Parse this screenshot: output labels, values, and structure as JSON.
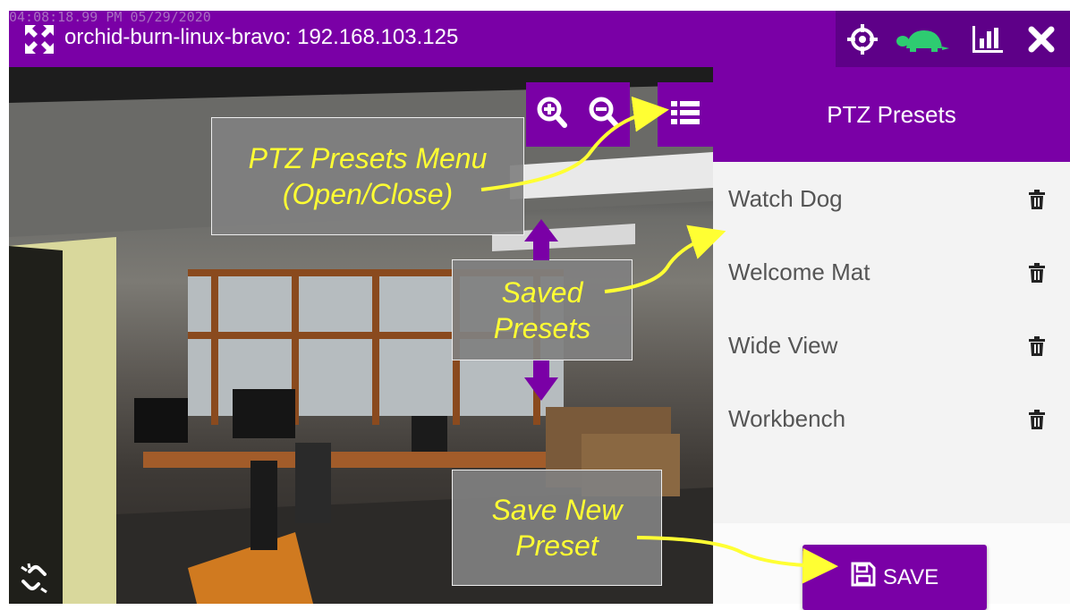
{
  "window": {
    "timestamp": "04:08:18.99 PM 05/29/2020",
    "title": "orchid-burn-linux-bravo: 192.168.103.125"
  },
  "toolbar": {
    "icons": [
      "ptz-target-icon",
      "turtle-icon",
      "stats-chart-icon",
      "close-icon"
    ]
  },
  "video": {
    "zoom_in_icon": "zoom-in-icon",
    "zoom_out_icon": "zoom-out-icon",
    "presets_menu_icon": "list-icon",
    "connection_icon": "disconnect-icon"
  },
  "panel": {
    "header": "PTZ Presets",
    "presets": [
      {
        "label": "Watch Dog"
      },
      {
        "label": "Welcome Mat"
      },
      {
        "label": "Wide View"
      },
      {
        "label": "Workbench"
      }
    ],
    "save_label": "SAVE"
  },
  "callouts": {
    "menu": "PTZ Presets Menu (Open/Close)",
    "saved_line1": "Saved",
    "saved_line2": "Presets",
    "save_new_line1": "Save New",
    "save_new_line2": "Preset"
  },
  "colors": {
    "brand_purple": "#7a00a6",
    "callout_text": "#ffff33",
    "turtle_green": "#2ecc71"
  }
}
